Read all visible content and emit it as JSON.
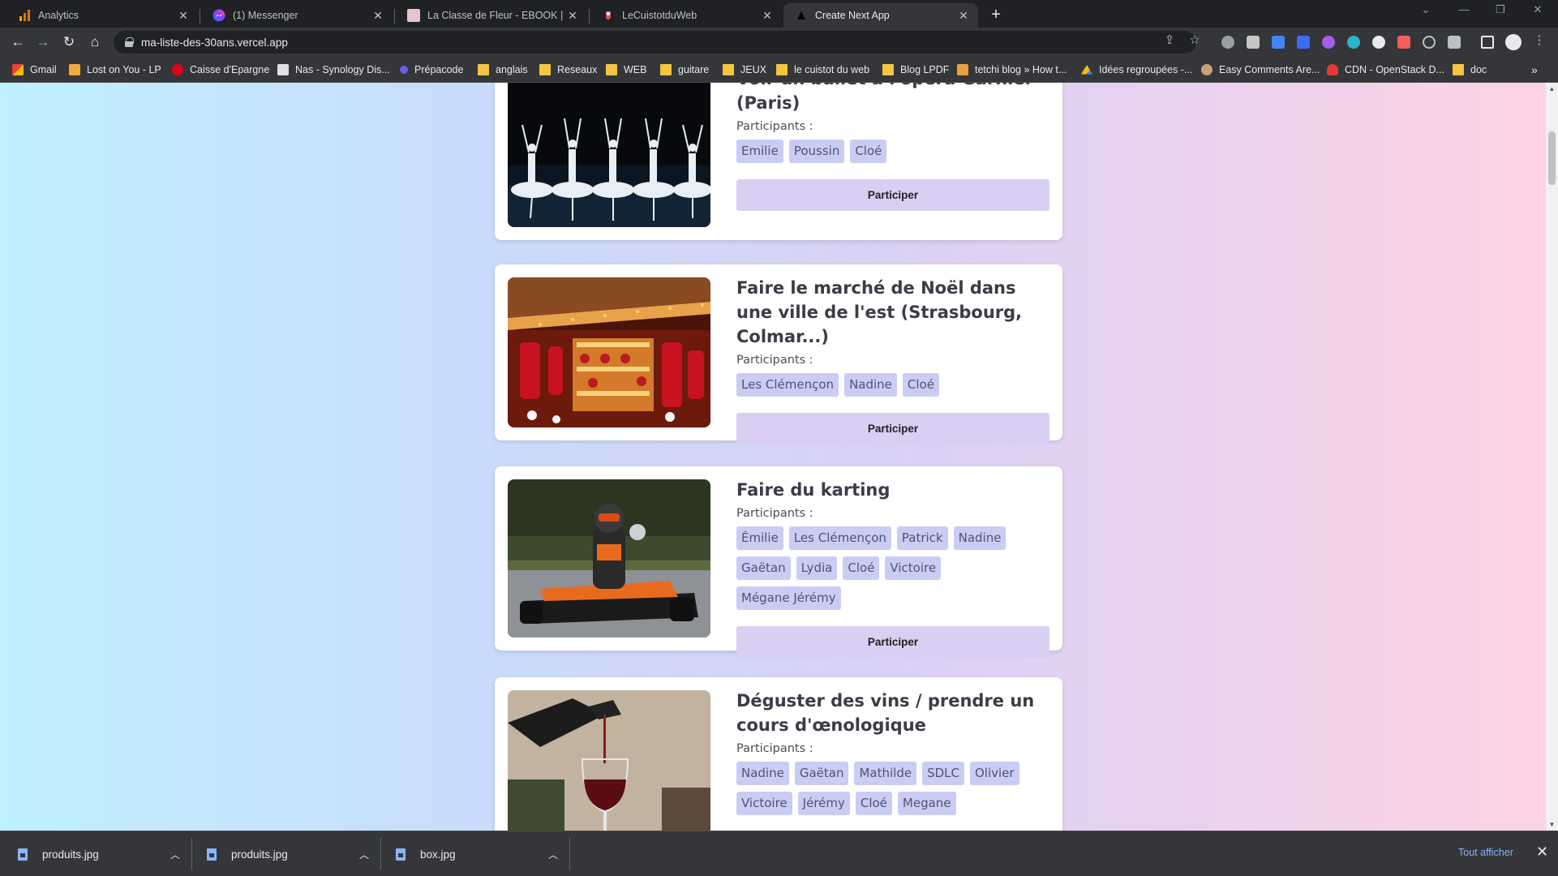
{
  "browser": {
    "tabs": [
      {
        "title": "Analytics",
        "icon": "analytics-icon",
        "active": false
      },
      {
        "title": "(1) Messenger",
        "icon": "messenger-icon",
        "active": false
      },
      {
        "title": "La Classe de Fleur - EBOOK | Gui",
        "icon": "fleur-icon",
        "active": false
      },
      {
        "title": "LeCuistotduWeb",
        "icon": "cuistot-icon",
        "active": false
      },
      {
        "title": "Create Next App",
        "icon": "nextjs-icon",
        "active": true
      }
    ],
    "new_tab": "+",
    "url": "ma-liste-des-30ans.vercel.app",
    "bookmarks": [
      {
        "label": "Gmail",
        "icon": "gmail-icon"
      },
      {
        "label": "Lost on You - LP",
        "icon": "music-icon"
      },
      {
        "label": "Caisse d'Epargne",
        "icon": "caisse-epargne-icon"
      },
      {
        "label": "Nas - Synology Dis...",
        "icon": "synology-icon"
      },
      {
        "label": "Prépacode",
        "icon": "prepacode-icon"
      },
      {
        "label": "anglais",
        "icon": "folder-icon"
      },
      {
        "label": "Reseaux",
        "icon": "folder-icon"
      },
      {
        "label": "WEB",
        "icon": "folder-icon"
      },
      {
        "label": "guitare",
        "icon": "folder-icon"
      },
      {
        "label": "JEUX",
        "icon": "folder-icon"
      },
      {
        "label": "le cuistot du web",
        "icon": "folder-icon"
      },
      {
        "label": "Blog LPDF",
        "icon": "folder-icon"
      },
      {
        "label": "tetchi blog » How t...",
        "icon": "tetchi-icon"
      },
      {
        "label": "Idées regroupées -...",
        "icon": "drive-icon"
      },
      {
        "label": "Easy Comments Are...",
        "icon": "avatar-icon"
      },
      {
        "label": "CDN - OpenStack D...",
        "icon": "cloud-icon"
      },
      {
        "label": "doc",
        "icon": "folder-icon"
      }
    ]
  },
  "page": {
    "participants_label": "Participants :",
    "button_label": "Participer",
    "activities": [
      {
        "title": "Voir un ballet à l'opéra Garnier (Paris)",
        "image": "ballet-photo",
        "participants": [
          "Emilie",
          "Poussin",
          "Cloé"
        ]
      },
      {
        "title": "Faire le marché de Noël dans une ville de l'est (Strasbourg, Colmar...)",
        "image": "christmas-market-photo",
        "participants": [
          "Les Clémençon",
          "Nadine",
          "Cloé"
        ]
      },
      {
        "title": "Faire du karting",
        "image": "karting-photo",
        "participants": [
          "Émilie",
          "Les Clémençon",
          "Patrick",
          "Nadine",
          "Gaëtan",
          "Lydia",
          "Cloé",
          "Victoire",
          "Mégane Jérémy"
        ]
      },
      {
        "title": "Déguster des vins / prendre un cours d'œnologique",
        "image": "wine-photo",
        "participants": [
          "Nadine",
          "Gaëtan",
          "Mathilde",
          "SDLC",
          "Olivier",
          "Victoire",
          "Jérémy",
          "Cloé",
          "Megane"
        ]
      }
    ]
  },
  "downloads": {
    "items": [
      {
        "name": "produits.jpg"
      },
      {
        "name": "produits.jpg"
      },
      {
        "name": "box.jpg"
      }
    ],
    "show_all": "Tout afficher"
  },
  "colors": {
    "chip_bg": "#c9cdf4",
    "button_bg": "#d8cff3",
    "gradient_left": "#bff0fd",
    "gradient_right": "#fdd3e4"
  }
}
